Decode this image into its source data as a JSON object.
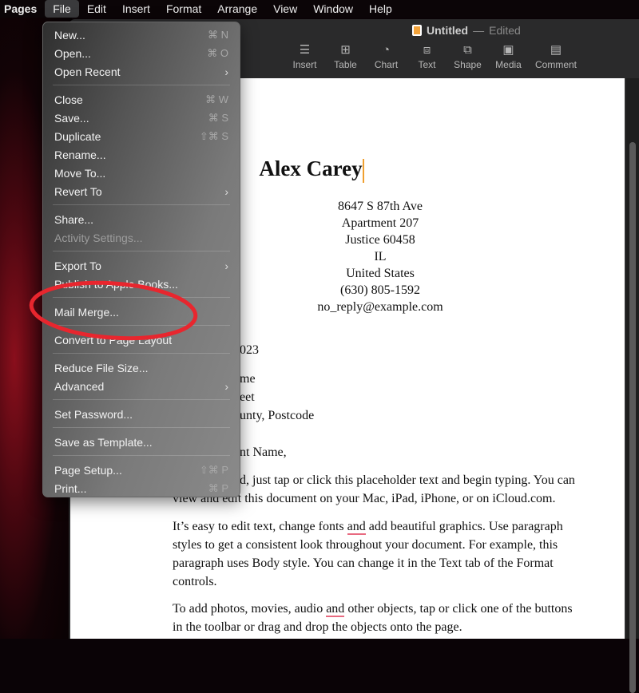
{
  "menubar": {
    "app": "Pages",
    "items": [
      "File",
      "Edit",
      "Insert",
      "Format",
      "Arrange",
      "View",
      "Window",
      "Help"
    ],
    "active": "File"
  },
  "window": {
    "title": "Untitled",
    "status": "Edited",
    "separator": "—"
  },
  "toolbar": [
    {
      "label": "Insert",
      "icon": "insert-icon"
    },
    {
      "label": "Table",
      "icon": "table-icon"
    },
    {
      "label": "Chart",
      "icon": "chart-icon"
    },
    {
      "label": "Text",
      "icon": "text-icon"
    },
    {
      "label": "Shape",
      "icon": "shape-icon"
    },
    {
      "label": "Media",
      "icon": "media-icon"
    },
    {
      "label": "Comment",
      "icon": "comment-icon"
    }
  ],
  "file_menu": [
    [
      {
        "label": "New...",
        "shortcut": "⌘ N"
      },
      {
        "label": "Open...",
        "shortcut": "⌘ O"
      },
      {
        "label": "Open Recent",
        "submenu": true
      }
    ],
    [
      {
        "label": "Close",
        "shortcut": "⌘ W"
      },
      {
        "label": "Save...",
        "shortcut": "⌘ S"
      },
      {
        "label": "Duplicate",
        "shortcut": "⇧⌘ S"
      },
      {
        "label": "Rename..."
      },
      {
        "label": "Move To..."
      },
      {
        "label": "Revert To",
        "submenu": true
      }
    ],
    [
      {
        "label": "Share..."
      },
      {
        "label": "Activity Settings...",
        "disabled": true
      }
    ],
    [
      {
        "label": "Export To",
        "submenu": true
      },
      {
        "label": "Publish to Apple Books..."
      }
    ],
    [
      {
        "label": "Mail Merge...",
        "highlighted_by_annotation": true
      }
    ],
    [
      {
        "label": "Convert to Page Layout"
      }
    ],
    [
      {
        "label": "Reduce File Size..."
      },
      {
        "label": "Advanced",
        "submenu": true
      }
    ],
    [
      {
        "label": "Set Password..."
      }
    ],
    [
      {
        "label": "Save as Template..."
      }
    ],
    [
      {
        "label": "Page Setup...",
        "shortcut": "⇧⌘ P"
      },
      {
        "label": "Print...",
        "shortcut": "⌘ P"
      }
    ]
  ],
  "document": {
    "name": "Alex Carey",
    "address": [
      "8647 S 87th Ave",
      "Apartment 207",
      "Justice 60458",
      "IL",
      "United States",
      "(630) 805-1592",
      "no_reply@example.com"
    ],
    "partial_lines": [
      "023",
      "me",
      "eet",
      "unty, Postcode",
      "nt Name,",
      "d, just tap or click this placeholder text and begin typing. You can"
    ],
    "p1_line2": "view and edit this document on your Mac, iPad, iPhone, or on iCloud.com.",
    "p2": [
      "It’s easy to edit text, change fonts ",
      "and",
      " add beautiful graphics. Use paragraph",
      "styles to get a consistent look throughout your document. For example, this",
      "paragraph uses Body style. You can change it in the Text tab of the Format",
      "controls."
    ],
    "p3": [
      "To add photos, movies, audio ",
      "and",
      " other objects, tap or click one of the buttons",
      "in the toolbar or drag and drop the objects onto the page."
    ]
  },
  "colors": {
    "annotation": "#e8262e",
    "caret": "#f0a030",
    "spellcheck": "#e86a80"
  }
}
